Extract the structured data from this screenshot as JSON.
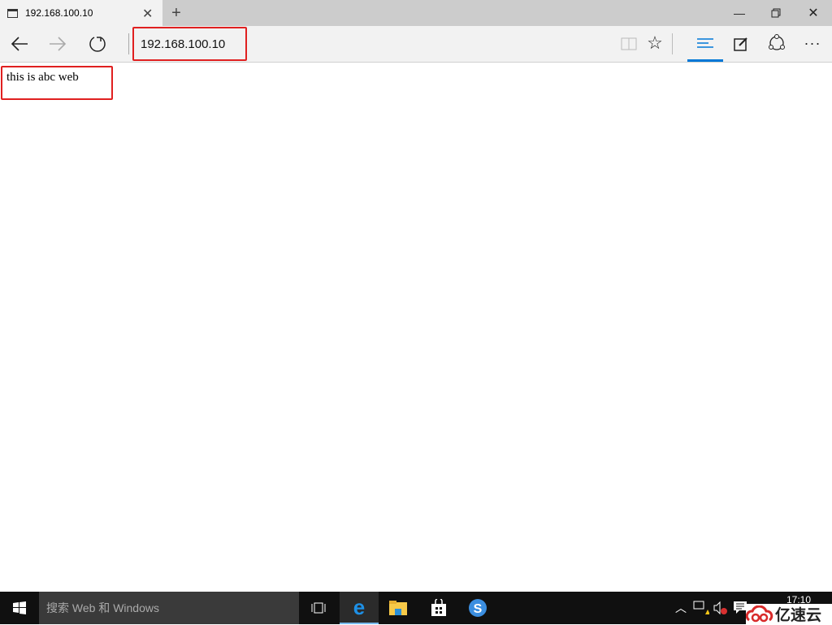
{
  "tab": {
    "title": "192.168.100.10"
  },
  "address": {
    "value": "192.168.100.10"
  },
  "page": {
    "text": "this is abc web"
  },
  "taskbar": {
    "search_placeholder": "搜索 Web 和 Windows",
    "time": "17:10",
    "watermark": "亿速云"
  },
  "colors": {
    "accent": "#0078d7",
    "highlight": "#e02020"
  }
}
